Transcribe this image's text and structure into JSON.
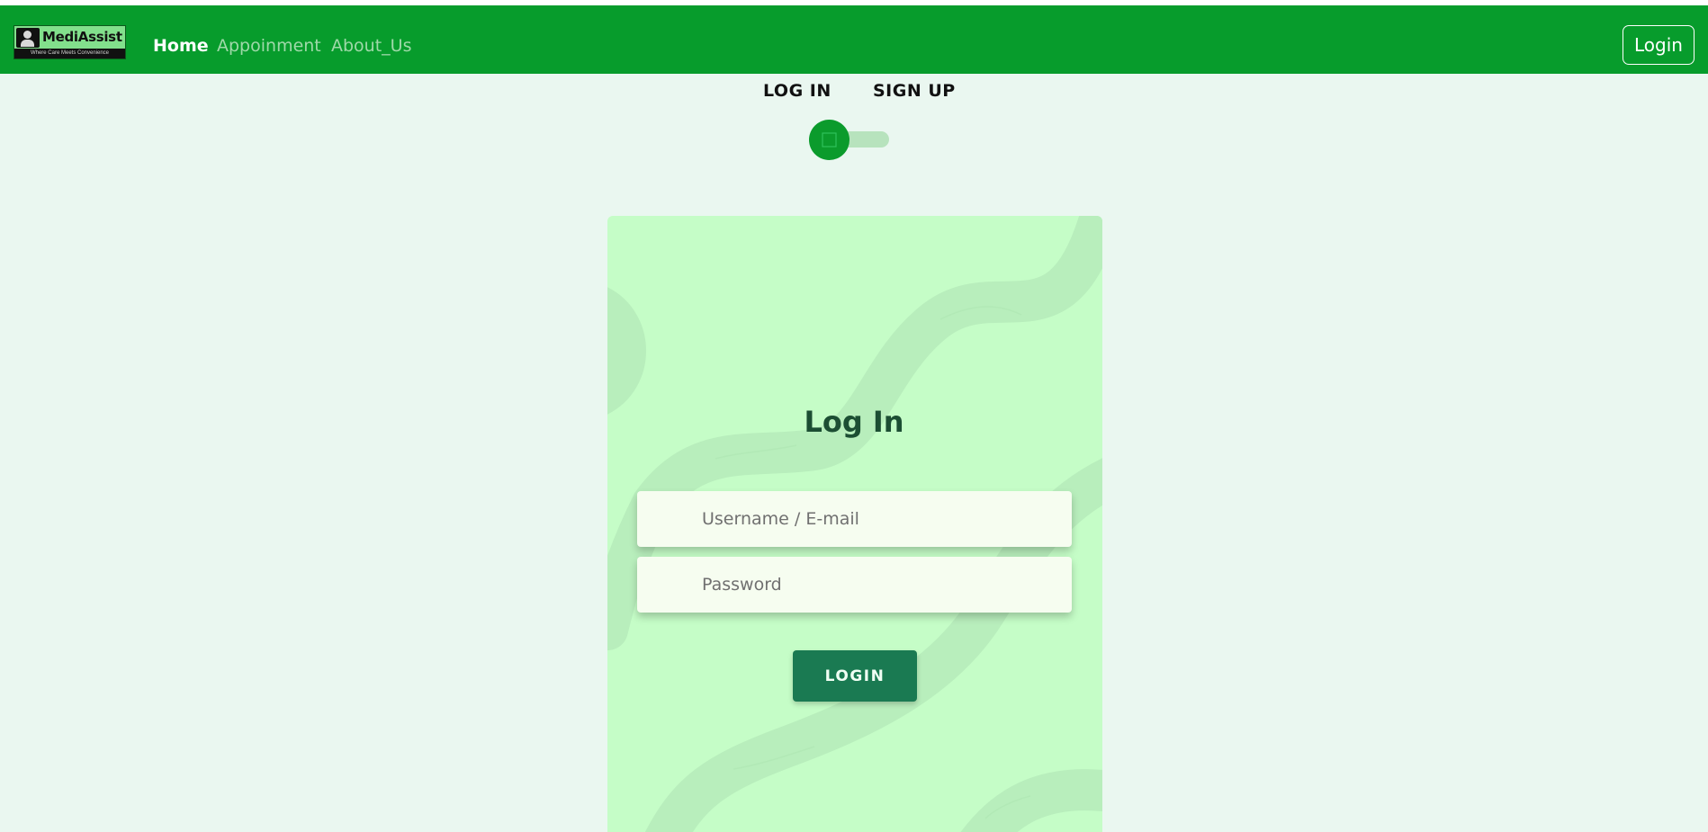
{
  "brand": {
    "name": "MediAssist",
    "tagline": "Where Care Meets Convenience"
  },
  "nav": {
    "links": [
      "Home",
      "Appoinment",
      "About_Us"
    ],
    "active": "Home",
    "login_label": "Login"
  },
  "auth_switch": {
    "left_label": "LOG IN",
    "right_label": "SIGN UP",
    "selected": "LOG IN"
  },
  "form": {
    "title": "Log In",
    "username_placeholder": "Username / E-mail",
    "password_placeholder": "Password",
    "submit_label": "LOGIN"
  },
  "colors": {
    "navbar": "#079c2c",
    "page_bg": "#eaf7f0",
    "card_bg": "#c5fdc7",
    "button": "#1a7a52",
    "title": "#1c4e33"
  }
}
